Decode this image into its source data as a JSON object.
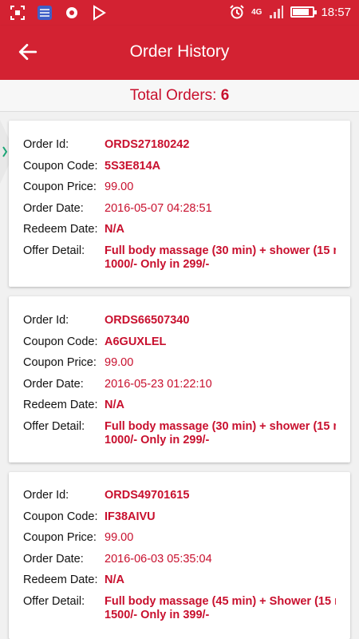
{
  "status_bar": {
    "time": "18:57",
    "network": "4G",
    "battery_level": 0.85,
    "accent_color": "#d32232",
    "left_icons": [
      "screenshot-icon",
      "keyboard-app-icon",
      "camera-app-icon",
      "play-store-icon"
    ],
    "right_icons": [
      "alarm-icon",
      "signal-icon",
      "battery-icon"
    ]
  },
  "app_bar": {
    "title": "Order History",
    "back_icon": "arrow-left-icon"
  },
  "summary": {
    "label": "Total Orders:",
    "count": "6"
  },
  "labels": {
    "order_id": "Order Id:",
    "coupon_code": "Coupon Code:",
    "coupon_price": "Coupon Price:",
    "order_date": "Order Date:",
    "redeem_date": "Redeem Date:",
    "offer_detail": "Offer Detail:"
  },
  "orders": [
    {
      "order_id": "ORDS27180242",
      "coupon_code": "5S3E814A",
      "coupon_price": "99.00",
      "order_date": "2016-05-07 04:28:51",
      "redeem_date": "N/A",
      "offer_line1": "Full body  massage (30 min) + shower (15 m",
      "offer_line2": "1000/- Only in 299/-"
    },
    {
      "order_id": "ORDS66507340",
      "coupon_code": "A6GUXLEL",
      "coupon_price": "99.00",
      "order_date": "2016-05-23 01:22:10",
      "redeem_date": "N/A",
      "offer_line1": "Full body  massage (30 min) + shower (15 m",
      "offer_line2": "1000/- Only in 299/-"
    },
    {
      "order_id": "ORDS49701615",
      "coupon_code": "IF38AIVU",
      "coupon_price": "99.00",
      "order_date": "2016-06-03 05:35:04",
      "redeem_date": "N/A",
      "offer_line1": "Full body massage (45 min) + Shower (15 m",
      "offer_line2": "1500/- Only in 399/-"
    }
  ]
}
